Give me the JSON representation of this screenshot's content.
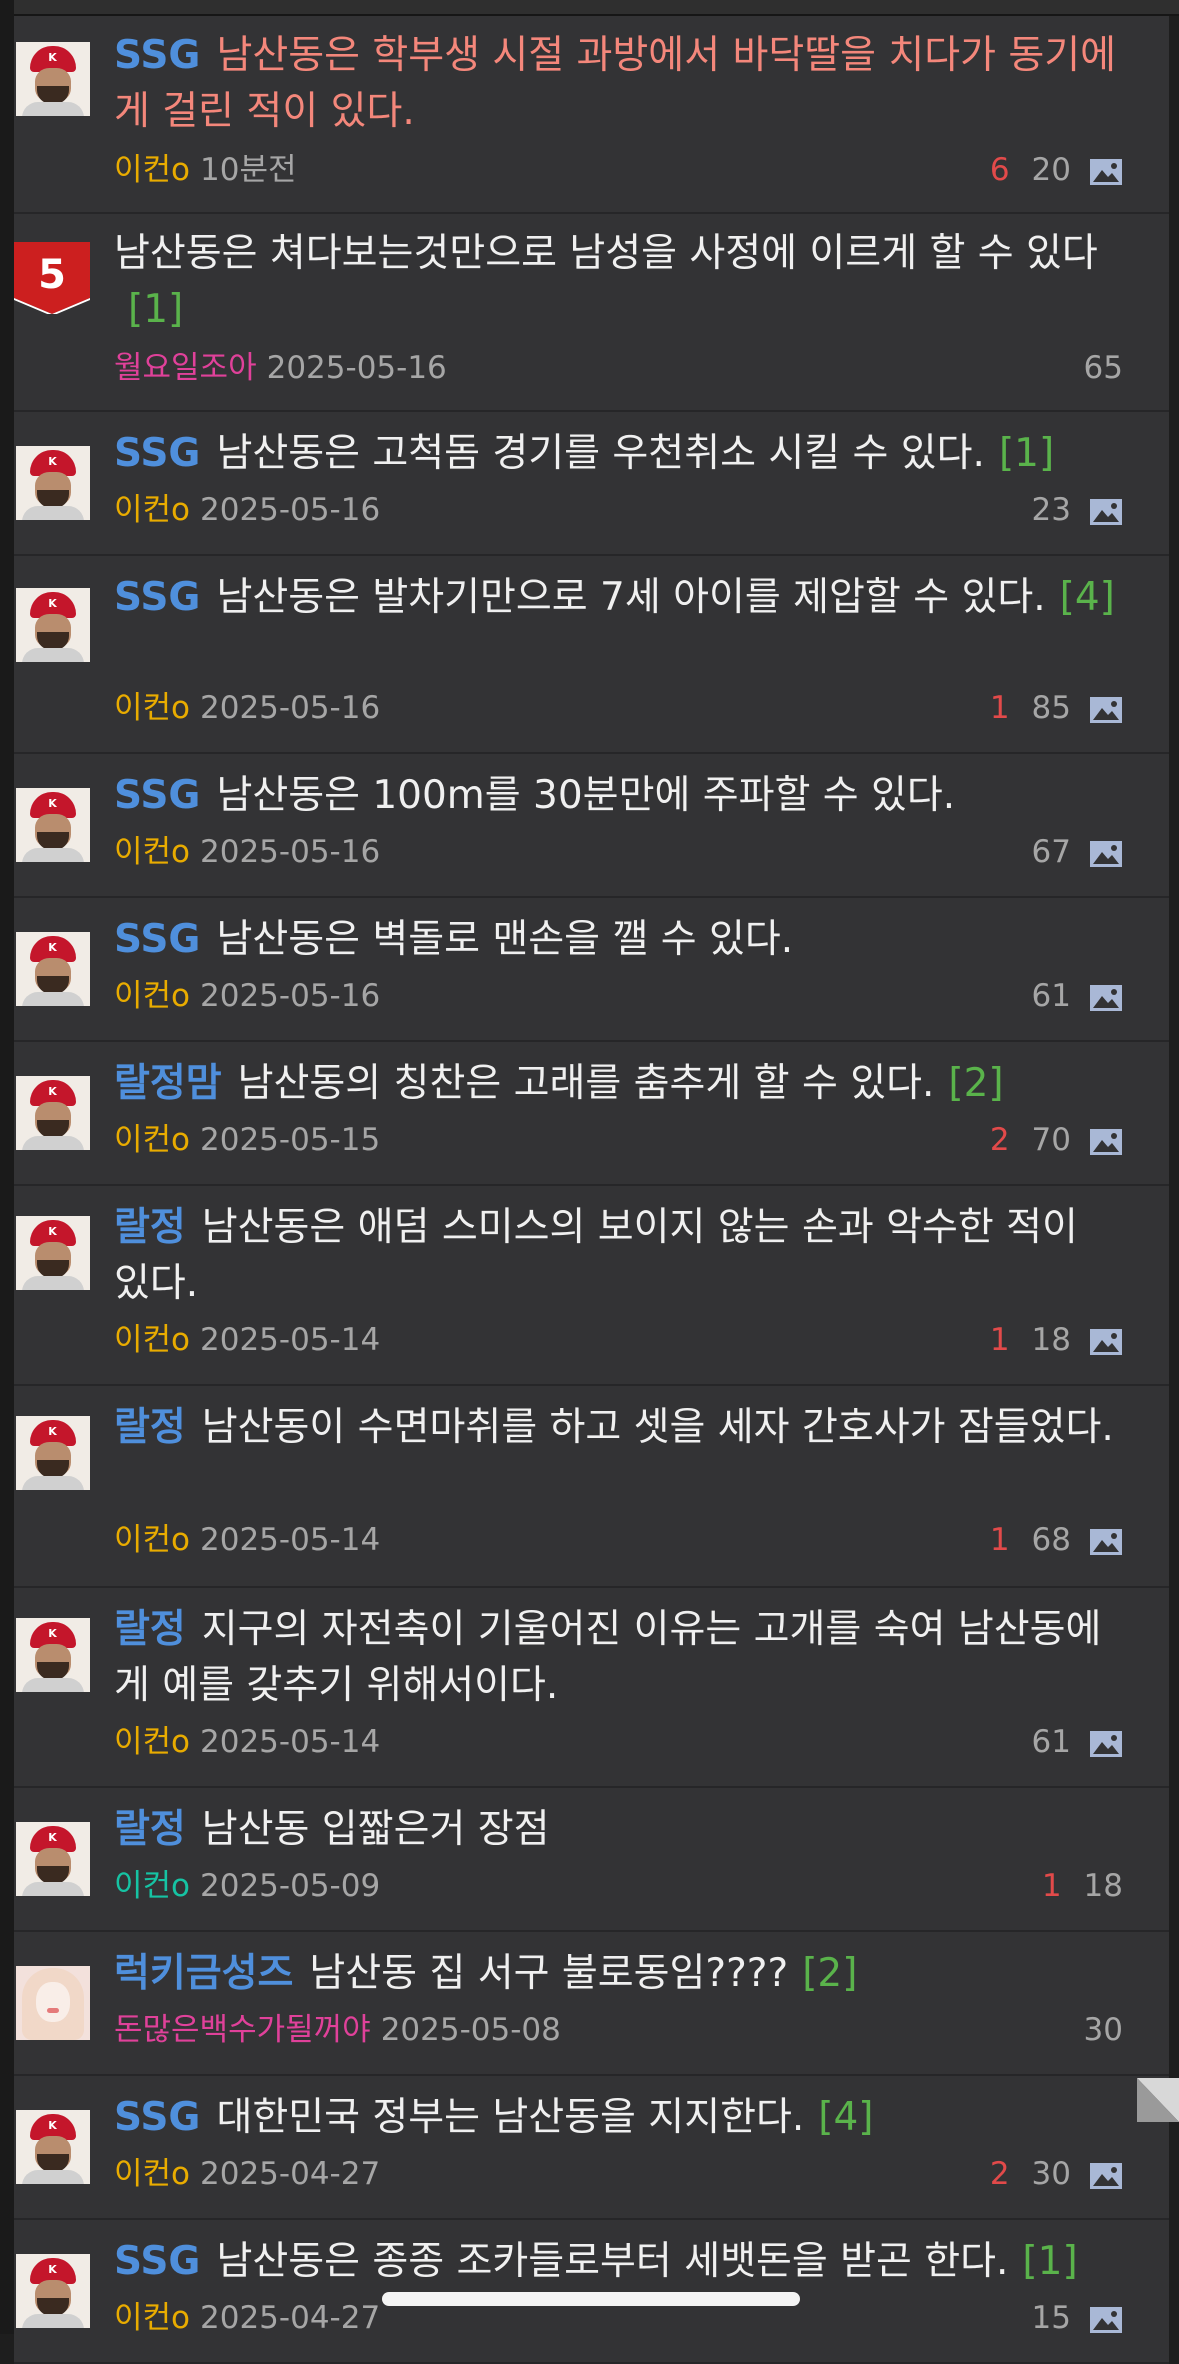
{
  "posts": [
    {
      "category": "SSG",
      "title": "남산동은 학부생 시절 과방에서 바닥딸을 치다가 동기에게 걸린 적이 있다.",
      "comments": "",
      "author": "이컨o",
      "date": "10분전",
      "recommend": "6",
      "views": "20",
      "has_image": true
    },
    {
      "category": "",
      "title": "남산동은 쳐다보는것만으로 남성을 사정에 이르게 할 수 있다",
      "comments": "[1]",
      "author": "월요일조아",
      "date": "2025-05-16",
      "recommend": "",
      "views": "65",
      "has_image": false,
      "rank": "5"
    },
    {
      "category": "SSG",
      "title": "남산동은 고척돔 경기를 우천취소 시킬 수 있다.",
      "comments": "[1]",
      "author": "이컨o",
      "date": "2025-05-16",
      "recommend": "",
      "views": "23",
      "has_image": true
    },
    {
      "category": "SSG",
      "title": "남산동은 발차기만으로 7세 아이를 제압할 수 있다.",
      "comments": "[4]",
      "author": "이컨o",
      "date": "2025-05-16",
      "recommend": "1",
      "views": "85",
      "has_image": true
    },
    {
      "category": "SSG",
      "title": "남산동은 100m를 30분만에 주파할 수 있다.",
      "comments": "",
      "author": "이컨o",
      "date": "2025-05-16",
      "recommend": "",
      "views": "67",
      "has_image": true
    },
    {
      "category": "SSG",
      "title": "남산동은 벽돌로 맨손을 깰 수 있다.",
      "comments": "",
      "author": "이컨o",
      "date": "2025-05-16",
      "recommend": "",
      "views": "61",
      "has_image": true
    },
    {
      "category": "랄정맘",
      "title": "남산동의 칭찬은 고래를 춤추게 할 수 있다.",
      "comments": "[2]",
      "author": "이컨o",
      "date": "2025-05-15",
      "recommend": "2",
      "views": "70",
      "has_image": true
    },
    {
      "category": "랄정",
      "title": "남산동은 애덤 스미스의 보이지 않는 손과 악수한 적이 있다.",
      "comments": "",
      "author": "이컨o",
      "date": "2025-05-14",
      "recommend": "1",
      "views": "18",
      "has_image": true
    },
    {
      "category": "랄정",
      "title": "남산동이 수면마취를 하고 셋을 세자 간호사가 잠들었다.",
      "comments": "",
      "author": "이컨o",
      "date": "2025-05-14",
      "recommend": "1",
      "views": "68",
      "has_image": true
    },
    {
      "category": "랄정",
      "title": "지구의 자전축이 기울어진 이유는 고개를 숙여 남산동에게 예를 갖추기 위해서이다.",
      "comments": "",
      "author": "이컨o",
      "date": "2025-05-14",
      "recommend": "",
      "views": "61",
      "has_image": true
    },
    {
      "category": "랄정",
      "title": "남산동 입짧은거 장점",
      "comments": "",
      "author": "이컨o",
      "date": "2025-05-09",
      "recommend": "1",
      "views": "18",
      "has_image": false
    },
    {
      "category": "럭키금성즈",
      "title": "남산동 집 서구 불로동임????",
      "comments": "[2]",
      "author": "돈많은백수가될꺼야",
      "date": "2025-05-08",
      "recommend": "",
      "views": "30",
      "has_image": false
    },
    {
      "category": "SSG",
      "title": "대한민국 정부는 남산동을 지지한다.",
      "comments": "[4]",
      "author": "이컨o",
      "date": "2025-04-27",
      "recommend": "2",
      "views": "30",
      "has_image": true
    },
    {
      "category": "SSG",
      "title": "남산동은 종종 조카들로부터 세뱃돈을 받곤 한다.",
      "comments": "[1]",
      "author": "이컨o",
      "date": "2025-04-27",
      "recommend": "",
      "views": "15",
      "has_image": true
    }
  ],
  "colors": {
    "background": "#333335",
    "category": "#4f8fdc",
    "comment_count": "#5ab34b",
    "recommend": "#e24a4a",
    "hot_title": "#f4877b"
  },
  "icons": {
    "image": "image-icon",
    "rank": "rank-badge",
    "scroll": "scroll-marker-icon"
  }
}
